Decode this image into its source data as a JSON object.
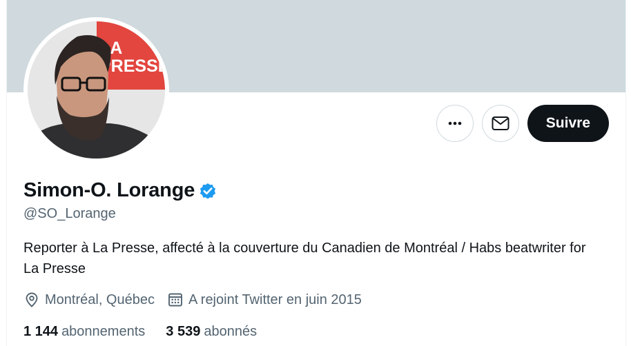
{
  "profile": {
    "display_name": "Simon-O. Lorange",
    "handle": "@SO_Lorange",
    "verified_badge_icon": "verified-badge-icon",
    "bio": "Reporter à La Presse, affecté à la couverture du Canadien de Montréal / Habs beatwriter for La Presse",
    "location": "Montréal, Québec",
    "joined": "A rejoint Twitter en juin 2015",
    "avatar_logo_text": [
      "LA",
      "PRESSE"
    ]
  },
  "actions": {
    "more_icon": "more-dots-icon",
    "message_icon": "envelope-icon",
    "follow_label": "Suivre"
  },
  "stats": {
    "following_count": "1 144",
    "following_label": "abonnements",
    "followers_count": "3 539",
    "followers_label": "abonnés"
  },
  "colors": {
    "banner": "#cfd9de",
    "verified": "#1d9bf0",
    "follow_button": "#0f1419",
    "secondary_text": "#536471",
    "logo_red": "#e2463f"
  }
}
